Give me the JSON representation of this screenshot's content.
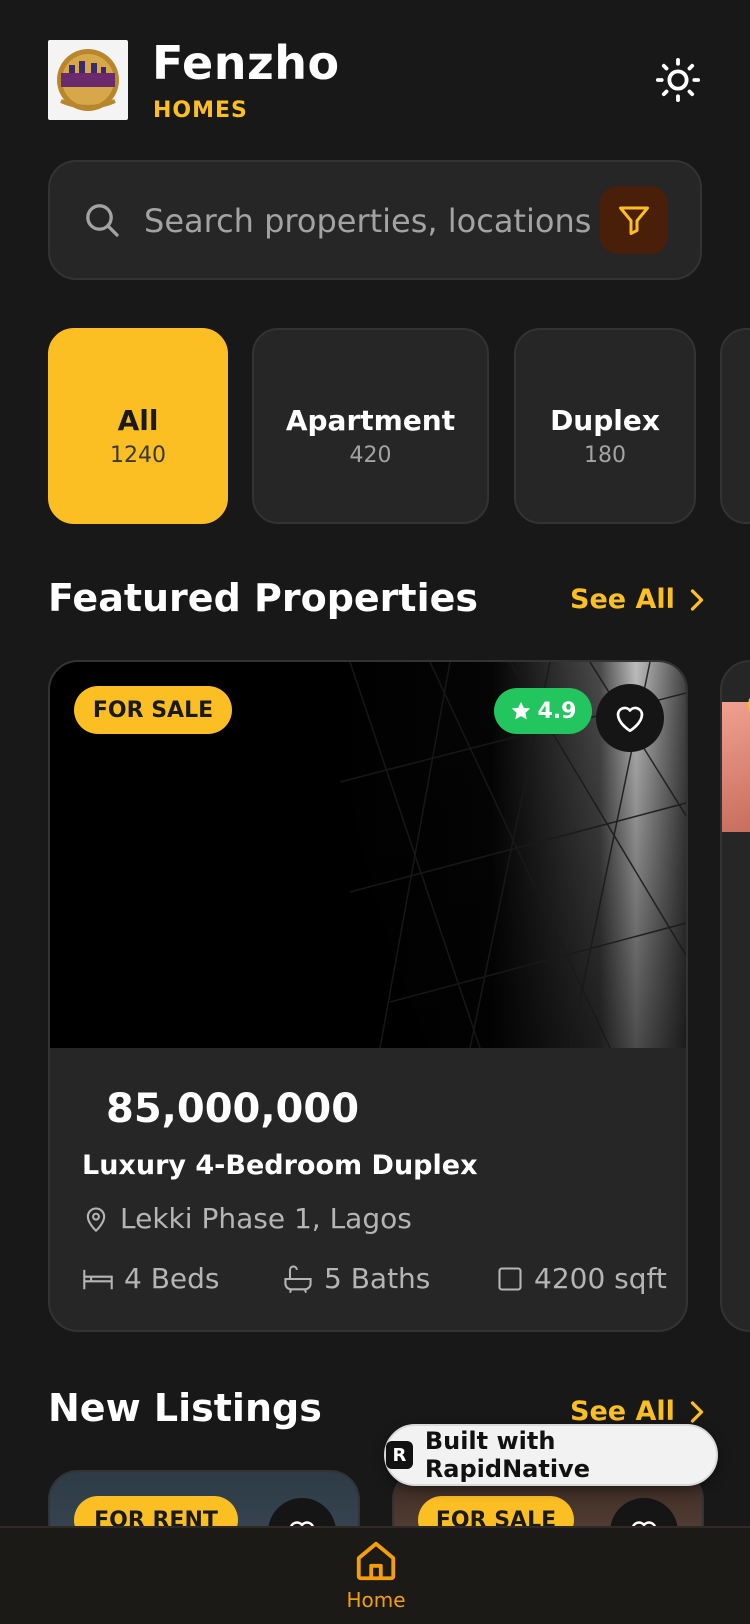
{
  "header": {
    "brand_name": "Fenzho",
    "brand_sub": "HOMES",
    "logo_text": "Fenzho Homes"
  },
  "search": {
    "placeholder": "Search properties, locations..."
  },
  "categories": [
    {
      "label": "All",
      "count": "1240",
      "active": true
    },
    {
      "label": "Apartment",
      "count": "420",
      "active": false
    },
    {
      "label": "Duplex",
      "count": "180",
      "active": false
    }
  ],
  "featured": {
    "title": "Featured Properties",
    "see_all": "See All",
    "card": {
      "badge": "FOR SALE",
      "rating": "4.9",
      "price": "85,000,000",
      "name": "Luxury 4-Bedroom Duplex",
      "location": "Lekki Phase 1, Lagos",
      "beds": "4 Beds",
      "baths": "5 Baths",
      "area": "4200 sqft"
    }
  },
  "new_listings": {
    "title": "New Listings",
    "see_all": "See All",
    "cards": [
      {
        "badge": "FOR RENT"
      },
      {
        "badge": "FOR SALE"
      }
    ]
  },
  "rapidnative": {
    "label": "Built with RapidNative"
  },
  "tabbar": {
    "home_label": "Home"
  },
  "colors": {
    "accent": "#fbbf24",
    "background": "#181818",
    "card": "#262626",
    "rating": "#22c55e"
  }
}
